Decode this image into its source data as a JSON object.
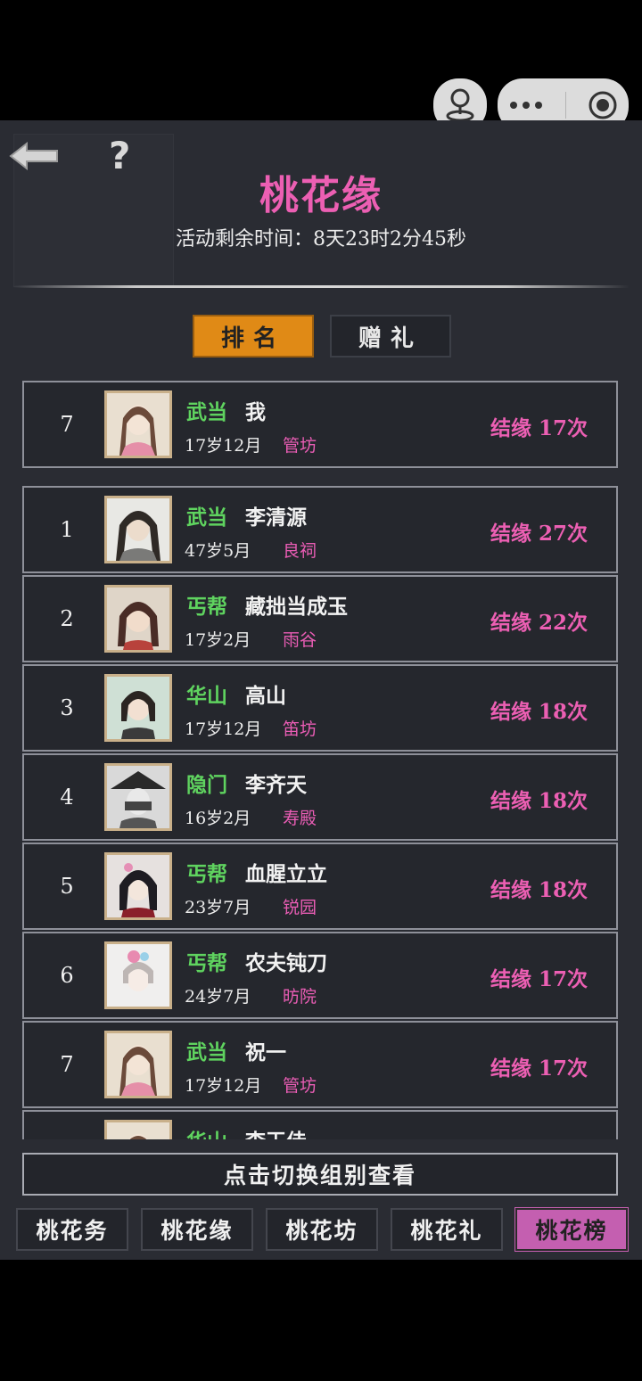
{
  "capsule": {
    "menu_icon": "more-dots-icon",
    "close_icon": "target-circle-icon",
    "left_icon": "joystick-icon"
  },
  "header": {
    "title": "桃花缘",
    "countdown": "活动剩余时间：8天23时2分45秒",
    "back_icon": "arrow-left-icon",
    "help_icon": "question-mark-icon",
    "help_symbol": "?"
  },
  "tabs": {
    "rank": "排名",
    "gift": "赠礼"
  },
  "my_entry": {
    "rank": "7",
    "sect": "武当",
    "name": "我",
    "age": "17岁12月",
    "place": "管坊",
    "score": "结缘 17次"
  },
  "ranking": [
    {
      "rank": "1",
      "sect": "武当",
      "name": "李清源",
      "age": "47岁5月",
      "place": "良祠",
      "score": "结缘 27次"
    },
    {
      "rank": "2",
      "sect": "丐帮",
      "name": "藏拙当成玉",
      "age": "17岁2月",
      "place": "雨谷",
      "score": "结缘 22次"
    },
    {
      "rank": "3",
      "sect": "华山",
      "name": "高山",
      "age": "17岁12月",
      "place": "笛坊",
      "score": "结缘 18次"
    },
    {
      "rank": "4",
      "sect": "隐门",
      "name": "李齐天",
      "age": "16岁2月",
      "place": "寿殿",
      "score": "结缘 18次"
    },
    {
      "rank": "5",
      "sect": "丐帮",
      "name": "血腥立立",
      "age": "23岁7月",
      "place": "锐园",
      "score": "结缘 18次"
    },
    {
      "rank": "6",
      "sect": "丐帮",
      "name": "农夫钝刀",
      "age": "24岁7月",
      "place": "昉院",
      "score": "结缘 17次"
    },
    {
      "rank": "7",
      "sect": "武当",
      "name": "祝一",
      "age": "17岁12月",
      "place": "管坊",
      "score": "结缘 17次"
    },
    {
      "rank": "",
      "sect": "华山",
      "name": "李玉佳",
      "age": "",
      "place": "",
      "score": ""
    }
  ],
  "switch_label": "点击切换组别查看",
  "bottom_tabs": [
    "桃花务",
    "桃花缘",
    "桃花坊",
    "桃花礼",
    "桃花榜"
  ],
  "colors": {
    "accent_pink": "#ec5fb3",
    "sect_green": "#5fd35f",
    "rank_tab_orange": "#e08a16",
    "active_bottom_tab": "#c45fb0"
  }
}
